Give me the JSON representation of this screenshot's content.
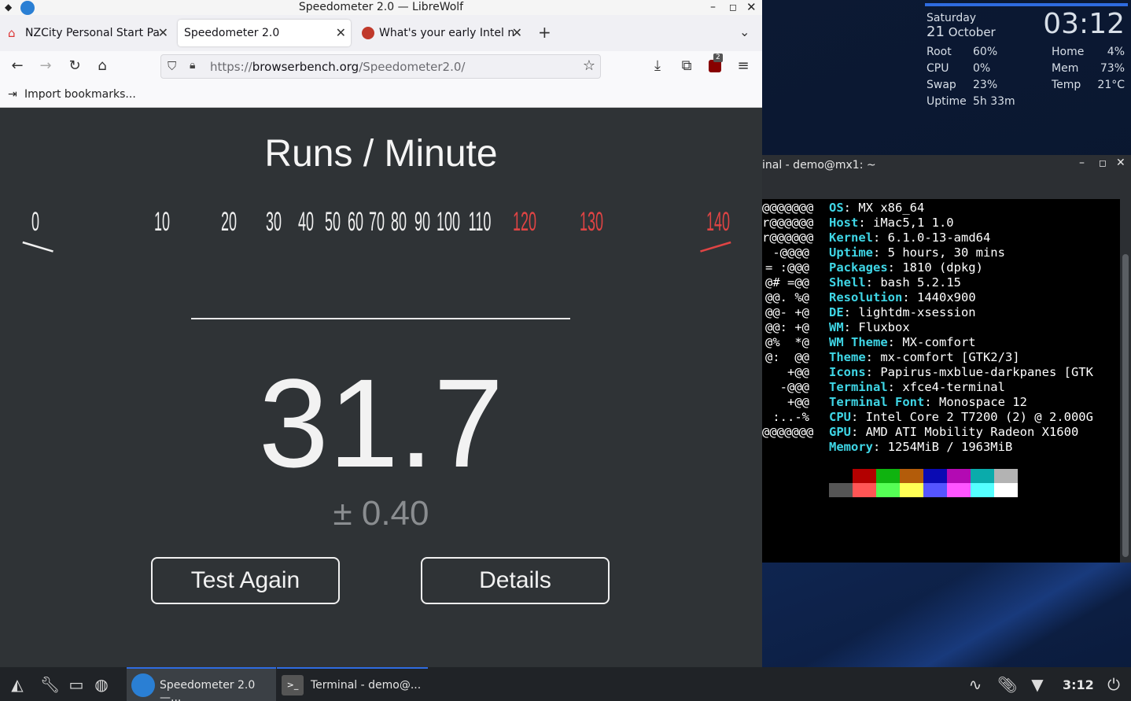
{
  "browser": {
    "window_title": "Speedometer 2.0 — LibreWolf",
    "tabs": [
      {
        "label": "NZCity Personal Start Pa",
        "active": false
      },
      {
        "label": "Speedometer 2.0",
        "active": true
      },
      {
        "label": "What's your early Intel n",
        "active": false
      }
    ],
    "url_prefix": "https://",
    "url_domain": "browserbench.org",
    "url_path": "/Speedometer2.0/",
    "bookmark": "Import bookmarks...",
    "extension_badge": "2"
  },
  "page": {
    "heading": "Runs / Minute",
    "score": "31.7",
    "margin": "± 0.40",
    "test_again": "Test Again",
    "details": "Details",
    "gauge": {
      "ticks": [
        "0",
        "10",
        "20",
        "30",
        "40",
        "50",
        "60",
        "70",
        "80",
        "90",
        "100",
        "110",
        "120",
        "130",
        "140"
      ],
      "value": 31.7,
      "max": 140,
      "red_from": 120,
      "colors": {
        "normal": "#f0f0f0",
        "red": "#e04444",
        "needle": "#f0a020"
      }
    }
  },
  "conky": {
    "day": "Saturday",
    "day_num": "21",
    "month": "October",
    "time": "03:12",
    "stats": [
      {
        "label": "Root",
        "value": "60%"
      },
      {
        "label": "CPU",
        "value": "0%"
      },
      {
        "label": "Swap",
        "value": "23%"
      },
      {
        "label": "Uptime",
        "value": "5h 33m"
      },
      {
        "label": "Home",
        "value": "4%"
      },
      {
        "label": "Mem",
        "value": "73%"
      },
      {
        "label": "Temp",
        "value": "21°C"
      }
    ]
  },
  "terminal": {
    "title": "inal - demo@mx1: ~",
    "logo": [
      "@@@@@@@",
      "r@@@@@@",
      "r@@@@@@",
      " -@@@@",
      "= :@@@",
      "@# =@@",
      "@@. %@",
      "@@- +@",
      "@@: +@",
      "@%  *@",
      "@:  @@",
      "  +@@",
      "  -@@@",
      "   +@@",
      " :..-%",
      "@@@@@@@"
    ],
    "info": [
      {
        "key": "OS",
        "value": ": MX x86_64"
      },
      {
        "key": "Host",
        "value": ": iMac5,1 1.0"
      },
      {
        "key": "Kernel",
        "value": ": 6.1.0-13-amd64"
      },
      {
        "key": "Uptime",
        "value": ": 5 hours, 30 mins"
      },
      {
        "key": "Packages",
        "value": ": 1810 (dpkg)"
      },
      {
        "key": "Shell",
        "value": ": bash 5.2.15"
      },
      {
        "key": "Resolution",
        "value": ": 1440x900"
      },
      {
        "key": "DE",
        "value": ": lightdm-xsession"
      },
      {
        "key": "WM",
        "value": ": Fluxbox"
      },
      {
        "key": "WM Theme",
        "value": ": MX-comfort"
      },
      {
        "key": "Theme",
        "value": ": mx-comfort [GTK2/3]"
      },
      {
        "key": "Icons",
        "value": ": Papirus-mxblue-darkpanes [GTK"
      },
      {
        "key": "Terminal",
        "value": ": xfce4-terminal"
      },
      {
        "key": "Terminal Font",
        "value": ": Monospace 12"
      },
      {
        "key": "CPU",
        "value": ": Intel Core 2 T7200 (2) @ 2.000G"
      },
      {
        "key": "GPU",
        "value": ": AMD ATI Mobility Radeon X1600"
      },
      {
        "key": "Memory",
        "value": ": 1254MiB / 1963MiB"
      }
    ],
    "palette_top": [
      "#000000",
      "#b30000",
      "#0fb30f",
      "#b35c0a",
      "#0a0ab3",
      "#b30ab3",
      "#0aabab",
      "#b3b3b3"
    ],
    "palette_bottom": [
      "#555555",
      "#ff5555",
      "#55ff55",
      "#ffff55",
      "#5555ff",
      "#ff55ff",
      "#55ffff",
      "#ffffff"
    ]
  },
  "taskbar": {
    "task_browser": "Speedometer 2.0 —...",
    "task_terminal": "Terminal - demo@...",
    "clock": "3:12"
  }
}
